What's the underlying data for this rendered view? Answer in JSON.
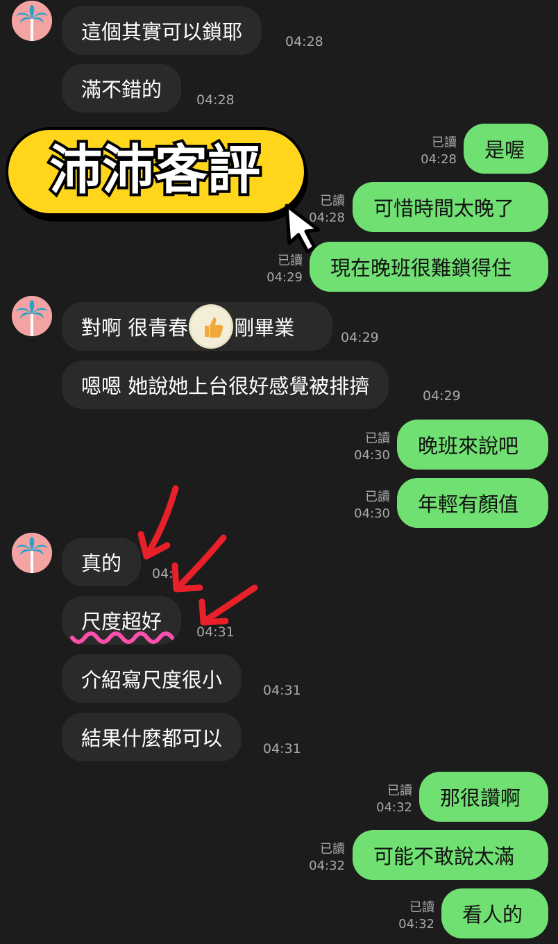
{
  "banner": {
    "title": "沛沛客評"
  },
  "read_label": "已讀",
  "messages": {
    "m1": {
      "text": "這個其實可以鎖耶",
      "time": "04:28"
    },
    "m2": {
      "text": "滿不錯的",
      "time": "04:28"
    },
    "m3": {
      "text": "是喔",
      "time": "04:28"
    },
    "m4": {
      "text": "可惜時間太晚了",
      "time": "04:28"
    },
    "m5": {
      "text": "現在晚班很難鎖得住",
      "time": "04:29"
    },
    "m6": {
      "text_a": "對啊 很青春",
      "emoji": "thumbs-up",
      "text_b": "剛畢業",
      "time": "04:29"
    },
    "m7": {
      "text": "嗯嗯 她說她上台很好感覺被排擠",
      "time": "04:29"
    },
    "m8": {
      "text": "晚班來說吧",
      "time": "04:30"
    },
    "m9": {
      "text": "年輕有顏值",
      "time": "04:30"
    },
    "m10": {
      "text": "真的",
      "time": "04:"
    },
    "m11": {
      "text": "尺度超好",
      "time": "04:31"
    },
    "m12": {
      "text": "介紹寫尺度很小",
      "time": "04:31"
    },
    "m13": {
      "text": "結果什麼都可以",
      "time": "04:31"
    },
    "m14": {
      "text": "那很讚啊",
      "time": "04:32"
    },
    "m15": {
      "text": "可能不敢說太滿",
      "time": "04:32"
    },
    "m16": {
      "text": "看人的",
      "time": "04:32"
    }
  },
  "colors": {
    "incoming": "#2a2a2a",
    "outgoing": "#70e072",
    "background": "#1c1c1c",
    "banner": "#ffd61c",
    "annotation": "#e8202a",
    "underline": "#ff4fae"
  }
}
